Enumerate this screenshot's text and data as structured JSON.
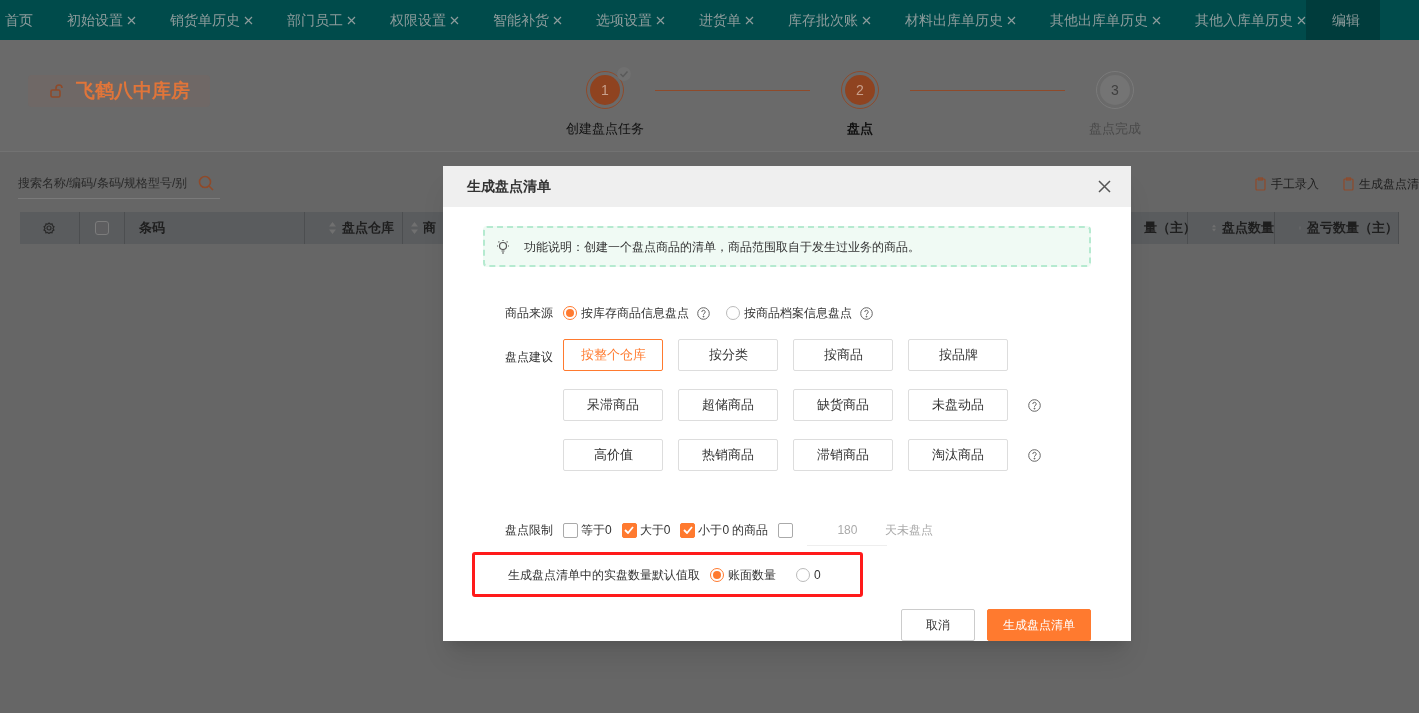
{
  "tabs": [
    {
      "label": "首页",
      "closable": false,
      "selected": false
    },
    {
      "label": "初始设置",
      "closable": true,
      "selected": false
    },
    {
      "label": "销货单历史",
      "closable": true,
      "selected": false
    },
    {
      "label": "部门员工",
      "closable": true,
      "selected": false
    },
    {
      "label": "权限设置",
      "closable": true,
      "selected": false
    },
    {
      "label": "智能补货",
      "closable": true,
      "selected": false
    },
    {
      "label": "选项设置",
      "closable": true,
      "selected": false
    },
    {
      "label": "进货单",
      "closable": true,
      "selected": false
    },
    {
      "label": "库存批次账",
      "closable": true,
      "selected": false
    },
    {
      "label": "材料出库单历史",
      "closable": true,
      "selected": false
    },
    {
      "label": "其他出库单历史",
      "closable": true,
      "selected": false
    },
    {
      "label": "其他入库单历史",
      "closable": true,
      "selected": false
    },
    {
      "label": "编辑",
      "closable": false,
      "selected": true
    }
  ],
  "store": {
    "name": "飞鹤八中库房"
  },
  "steps": [
    {
      "number": "1",
      "label": "创建盘点任务",
      "completed": true,
      "current": false
    },
    {
      "number": "2",
      "label": "盘点",
      "completed": false,
      "current": true
    },
    {
      "number": "3",
      "label": "盘点完成",
      "completed": false,
      "current": false
    }
  ],
  "search": {
    "placeholder": "搜索名称/编码/条码/规格型号/别"
  },
  "toolbar_actions": [
    {
      "label": "手工录入"
    },
    {
      "label": "生成盘点清"
    }
  ],
  "table": {
    "columns": [
      {
        "kind": "settings"
      },
      {
        "kind": "checkbox",
        "checked": false
      },
      {
        "kind": "plain",
        "label": "条码"
      },
      {
        "kind": "sortable",
        "label": "盘点仓库"
      },
      {
        "kind": "sortable",
        "label": "商"
      },
      {
        "kind": "plain",
        "label": "量（主）"
      },
      {
        "kind": "sortable",
        "label": "盘点数量"
      },
      {
        "kind": "sortable",
        "label": "盈亏数量（主）"
      }
    ]
  },
  "dialog": {
    "title": "生成盘点清单",
    "notice": "功能说明：创建一个盘点商品的清单，商品范围取自于发生过业务的商品。",
    "source": {
      "label": "商品来源",
      "options": [
        {
          "kind": "with_help",
          "label": "按库存商品信息盘点",
          "selected": true
        },
        {
          "kind": "with_help",
          "label": "按商品档案信息盘点",
          "selected": false
        }
      ]
    },
    "suggestion": {
      "label": "盘点建议",
      "rows": [
        {
          "kind": "plain",
          "buttons": [
            {
              "label": "按整个仓库",
              "selected": true
            },
            {
              "label": "按分类",
              "selected": false
            },
            {
              "label": "按商品",
              "selected": false
            },
            {
              "label": "按品牌",
              "selected": false
            }
          ]
        },
        {
          "kind": "with_help",
          "buttons": [
            {
              "label": "呆滞商品",
              "selected": false
            },
            {
              "label": "超储商品",
              "selected": false
            },
            {
              "label": "缺货商品",
              "selected": false
            },
            {
              "label": "未盘动品",
              "selected": false
            }
          ]
        },
        {
          "kind": "with_help",
          "buttons": [
            {
              "label": "高价值",
              "selected": false
            },
            {
              "label": "热销商品",
              "selected": false
            },
            {
              "label": "滞销商品",
              "selected": false
            },
            {
              "label": "淘汰商品",
              "selected": false
            }
          ]
        }
      ]
    },
    "limit": {
      "label": "盘点限制",
      "options": [
        {
          "label": "等于0",
          "checked": false
        },
        {
          "label": "大于0",
          "checked": true
        },
        {
          "label": "小于0 的商品",
          "checked": true
        }
      ],
      "days": {
        "checked": false,
        "value": "180",
        "suffix": "天未盘点"
      }
    },
    "default_qty": {
      "label": "生成盘点清单中的实盘数量默认值取",
      "highlighted": true,
      "options": [
        {
          "label": "账面数量",
          "selected": true
        },
        {
          "label": "0",
          "selected": false
        }
      ]
    },
    "buttons": [
      {
        "label": "取消",
        "kind": "secondary"
      },
      {
        "label": "生成盘点清单",
        "kind": "primary"
      }
    ]
  }
}
